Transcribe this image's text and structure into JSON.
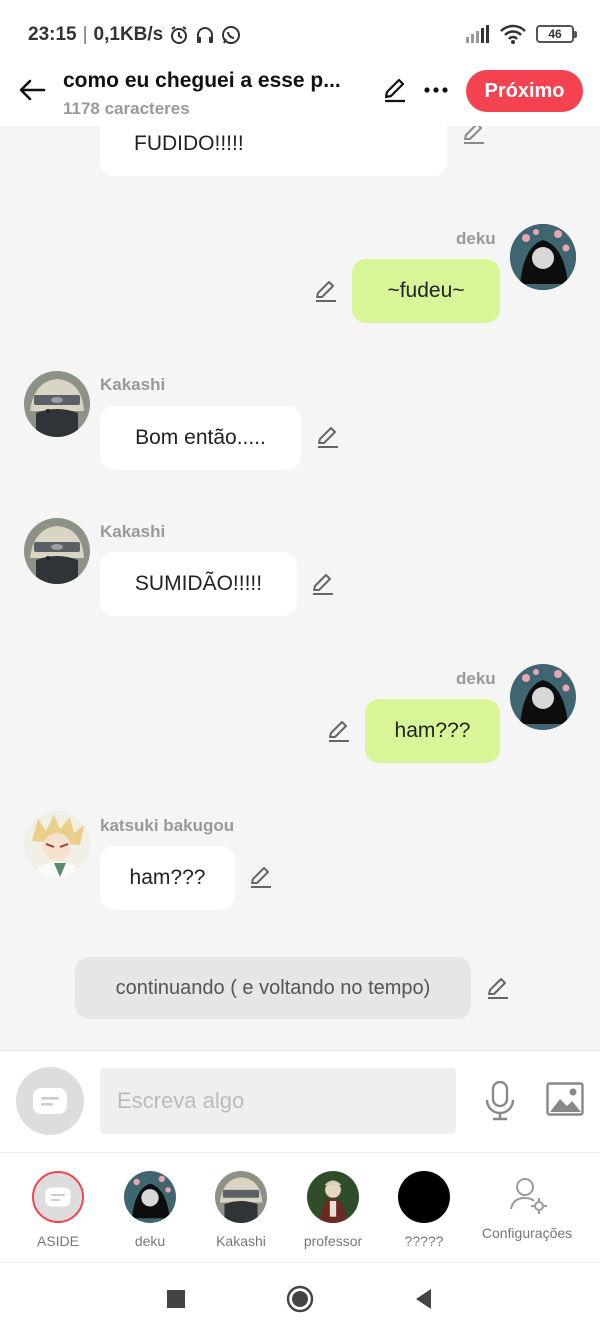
{
  "status": {
    "time": "23:15",
    "speed": "0,1KB/s",
    "battery": "46"
  },
  "header": {
    "title": "como eu cheguei a esse p...",
    "subtitle": "1178 caracteres",
    "next_label": "Próximo",
    "accent": "#f44250"
  },
  "messages": [
    {
      "speaker": "",
      "text": "FUDIDO!!!!!",
      "side": "left"
    },
    {
      "speaker": "deku",
      "text": "~fudeu~",
      "side": "right"
    },
    {
      "speaker": "Kakashi",
      "text": "Bom então.....",
      "side": "left"
    },
    {
      "speaker": "Kakashi",
      "text": "SUMIDÃO!!!!!",
      "side": "left"
    },
    {
      "speaker": "deku",
      "text": "ham???",
      "side": "right"
    },
    {
      "speaker": "katsuki bakugou",
      "text": "ham???",
      "side": "left"
    },
    {
      "speaker": "",
      "text": "continuando ( e voltando no tempo)",
      "side": "aside"
    }
  ],
  "input": {
    "placeholder": "Escreva algo"
  },
  "characters": [
    {
      "label": "ASIDE"
    },
    {
      "label": "deku"
    },
    {
      "label": "Kakashi"
    },
    {
      "label": "professor"
    },
    {
      "label": "?????"
    },
    {
      "label": "Configurações"
    }
  ],
  "colors": {
    "user_bubble": "#d8f598",
    "other_bubble": "#ffffff",
    "aside_bubble": "#e6e6e6"
  }
}
